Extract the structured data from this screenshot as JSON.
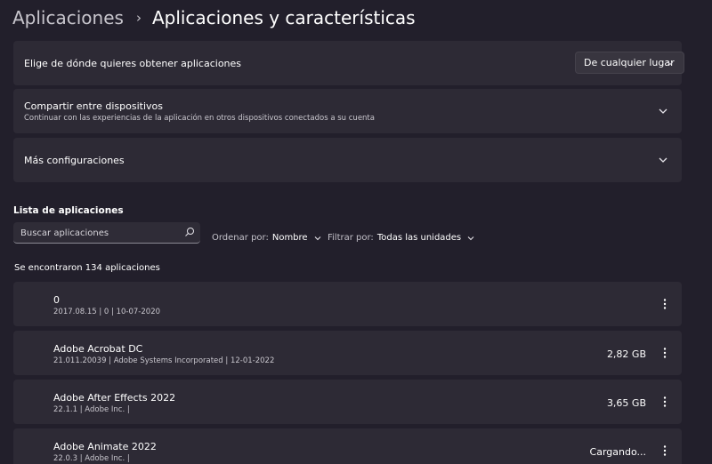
{
  "breadcrumb": {
    "parent": "Aplicaciones",
    "separator": "›",
    "current": "Aplicaciones y características"
  },
  "settings": {
    "source": {
      "title": "Elige de dónde quieres obtener aplicaciones",
      "dropdown_value": "De cualquier lugar"
    },
    "share": {
      "title": "Compartir entre dispositivos",
      "subtitle": "Continuar con las experiencias de la aplicación en otros dispositivos conectados a su cuenta"
    },
    "more": {
      "title": "Más configuraciones"
    }
  },
  "app_list": {
    "heading": "Lista de aplicaciones",
    "search_placeholder": "Buscar aplicaciones",
    "sort_label": "Ordenar por:",
    "sort_value": "Nombre",
    "filter_label": "Filtrar por:",
    "filter_value": "Todas las unidades",
    "count_text": "Se encontraron 134 aplicaciones",
    "apps": [
      {
        "name": "0",
        "meta": "2017.08.15   |   0   |   10-07-2020",
        "size": ""
      },
      {
        "name": "Adobe Acrobat DC",
        "meta": "21.011.20039   |   Adobe Systems Incorporated   |   12-01-2022",
        "size": "2,82 GB"
      },
      {
        "name": "Adobe After Effects 2022",
        "meta": "22.1.1   |   Adobe Inc.   |",
        "size": "3,65 GB"
      },
      {
        "name": "Adobe Animate 2022",
        "meta": "22.0.3   |   Adobe Inc.   |",
        "size": "Cargando..."
      }
    ]
  },
  "icons": {
    "chevron": "chevron-down-icon",
    "search": "search-icon",
    "more": "more-vertical-icon"
  }
}
